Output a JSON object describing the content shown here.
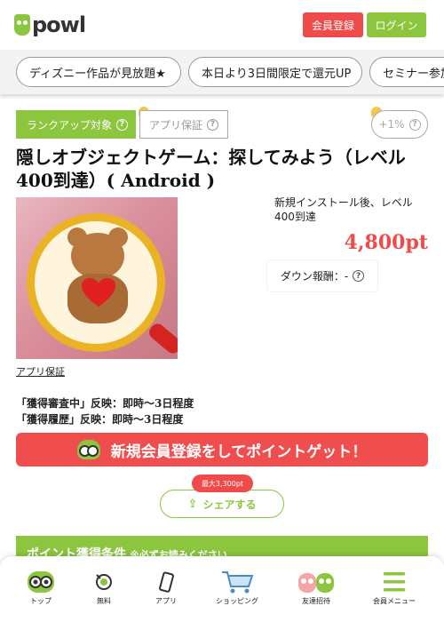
{
  "header": {
    "logo_text": "powl",
    "register_label": "会員登録",
    "login_label": "ログイン"
  },
  "campaigns": [
    "ディズニー作品が見放題★",
    "本日より3日間限定で還元UP",
    "セミナー参加"
  ],
  "tags": {
    "rankup": "ランクアップ対象",
    "guarantee": "アプリ保証",
    "bonus": "+1%"
  },
  "offer": {
    "title": "隠しオブジェクトゲーム：探してみよう（レベル400到達）( Android )",
    "condition": "新規インストール後、レベル400到達",
    "points": "4,800pt",
    "down_reward": "ダウン報酬：-",
    "guarantee_link": "アプリ保証",
    "reflect_pending": "「獲得審査中」反映：即時～3日程度",
    "reflect_history": "「獲得履歴」反映：即時～3日程度"
  },
  "signup_cta": "新規会員登録をしてポイントゲット！",
  "share": {
    "badge": "最大3,300pt",
    "label": "シェアする"
  },
  "conditions_header": {
    "title": "ポイント獲得条件",
    "note": "※必ずお読みください"
  },
  "bottom_nav": [
    {
      "label": "トップ",
      "icon": "owl-icon"
    },
    {
      "label": "無料",
      "icon": "free-icon"
    },
    {
      "label": "アプリ",
      "icon": "smartphone-icon"
    },
    {
      "label": "ショッピング",
      "icon": "cart-icon"
    },
    {
      "label": "友達招待",
      "icon": "friends-icon"
    },
    {
      "label": "会員メニュー",
      "icon": "menu-icon"
    }
  ],
  "colors": {
    "brand_green": "#8cc63f",
    "accent_red": "#ef4b4b"
  }
}
